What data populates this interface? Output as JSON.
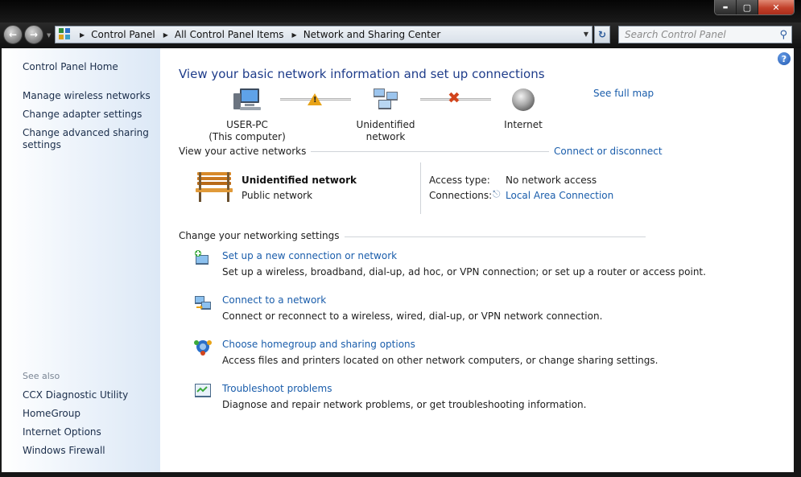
{
  "address": {
    "crumbs": [
      "Control Panel",
      "All Control Panel Items",
      "Network and Sharing Center"
    ]
  },
  "search": {
    "placeholder": "Search Control Panel"
  },
  "window_controls": {
    "minimize": "▬",
    "maximize": "▢",
    "close": "✕"
  },
  "sidebar": {
    "home": "Control Panel Home",
    "links": [
      "Manage wireless networks",
      "Change adapter settings",
      "Change advanced sharing settings"
    ],
    "see_also_label": "See also",
    "see_also": [
      "CCX Diagnostic Utility",
      "HomeGroup",
      "Internet Options",
      "Windows Firewall"
    ]
  },
  "main": {
    "title": "View your basic network information and set up connections",
    "see_full_map": "See full map",
    "map": {
      "computer_name": "USER-PC",
      "computer_sub": "(This computer)",
      "network": "Unidentified network",
      "internet": "Internet"
    },
    "active": {
      "label": "View your active networks",
      "connect_link": "Connect or disconnect",
      "network_name": "Unidentified network",
      "network_type": "Public network",
      "access_label": "Access type:",
      "access_value": "No network access",
      "connections_label": "Connections:",
      "connections_value": "Local Area Connection"
    },
    "settings": {
      "label": "Change your networking settings",
      "tasks": [
        {
          "title": "Set up a new connection or network",
          "desc": "Set up a wireless, broadband, dial-up, ad hoc, or VPN connection; or set up a router or access point."
        },
        {
          "title": "Connect to a network",
          "desc": "Connect or reconnect to a wireless, wired, dial-up, or VPN network connection."
        },
        {
          "title": "Choose homegroup and sharing options",
          "desc": "Access files and printers located on other network computers, or change sharing settings."
        },
        {
          "title": "Troubleshoot problems",
          "desc": "Diagnose and repair network problems, or get troubleshooting information."
        }
      ]
    }
  },
  "colors": {
    "link": "#1a5dab",
    "title": "#1e3c8a",
    "warning": "#e8a317",
    "error": "#d2441c"
  }
}
